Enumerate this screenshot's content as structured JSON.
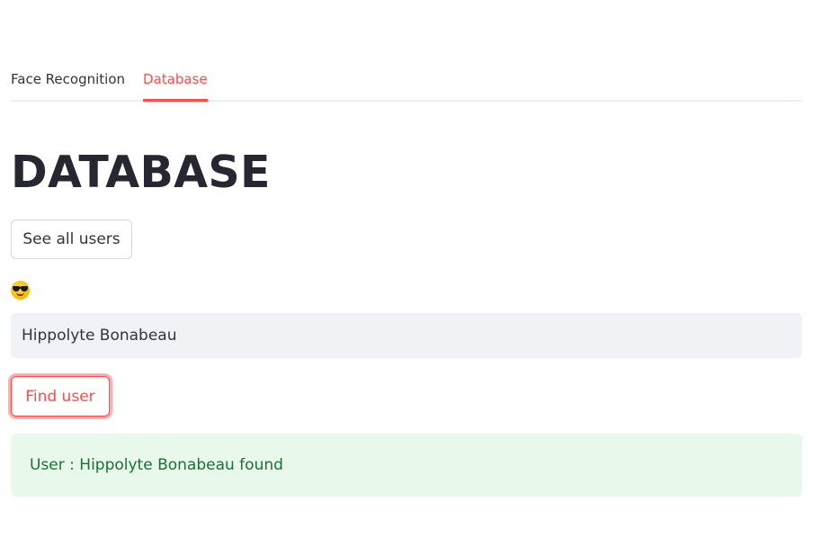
{
  "tabs": [
    {
      "label": "Face Recognition",
      "active": false
    },
    {
      "label": "Database",
      "active": true
    }
  ],
  "main": {
    "title": "DATABASE",
    "see_all_button": "See all users",
    "input_label_icon": "sunglasses-face-emoji",
    "name_input_value": "Hippolyte Bonabeau",
    "find_user_button": "Find user",
    "result_message": "User : Hippolyte Bonabeau found"
  },
  "colors": {
    "accent": "#ff4b4b",
    "text": "#31333f",
    "title": "#262730",
    "input_bg": "#f0f2f6",
    "success_bg": "#e8f8eb",
    "success_text": "#177233"
  }
}
